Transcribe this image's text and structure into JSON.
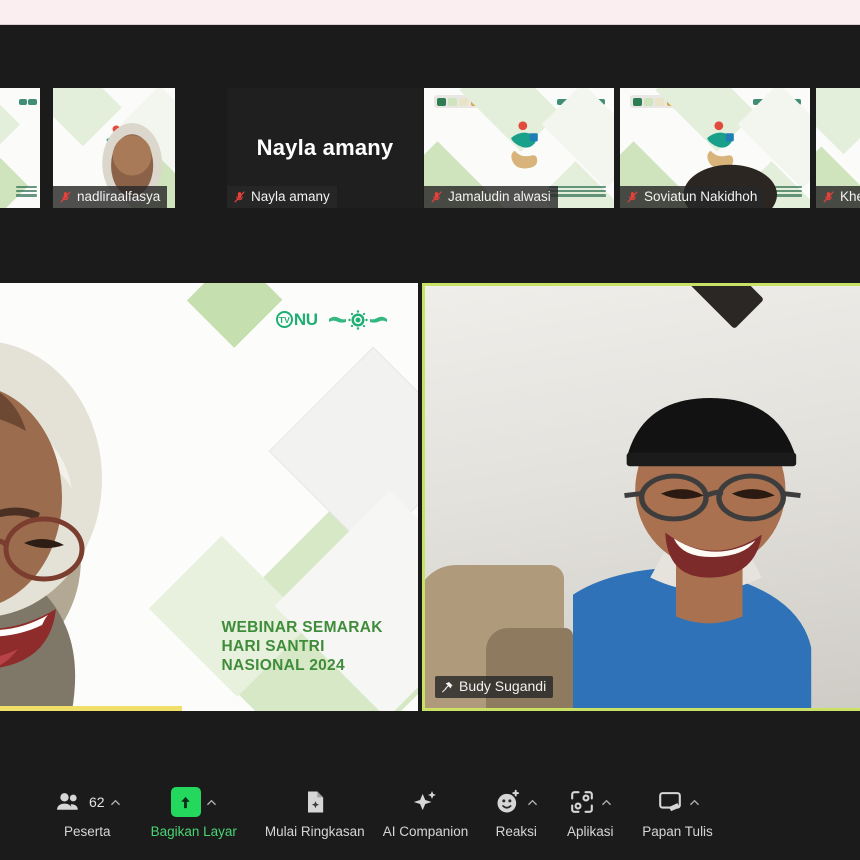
{
  "window": {
    "app": "Zoom Meeting",
    "top_band_color": "#faeef1",
    "background_color": "#1b1b1b"
  },
  "filmstrip": {
    "tiles": [
      {
        "name": "",
        "label": "",
        "has_video": true,
        "muted": true,
        "partial": "left"
      },
      {
        "name": "nadliraalfasya",
        "label": "nadliraalfasya",
        "has_video": true,
        "muted": true
      },
      {
        "name": "Nayla amany",
        "label": "Nayla amany",
        "has_video": false,
        "muted": true
      },
      {
        "name": "Jamaludin alwasi",
        "label": "Jamaludin alwasi",
        "has_video": true,
        "muted": true
      },
      {
        "name": "Soviatun Nakidhoh",
        "label": "Soviatun Nakidhoh",
        "has_video": true,
        "muted": true
      },
      {
        "name": "Khe",
        "label": "Khe",
        "has_video": true,
        "muted": true,
        "partial": "right"
      }
    ],
    "mic_icon": "microphone-off-icon",
    "mic_icon_color": "#e8413a"
  },
  "stage": {
    "left_tile": {
      "name": "webinar-presenter",
      "active_speaker": true,
      "active_border_color": "#f0e06a",
      "slide": {
        "logo_primary": "TV",
        "logo_text": "NU",
        "logo_color": "#1faf73",
        "title_line1": "WEBINAR SEMARAK",
        "title_line2": "HARI SANTRI",
        "title_line3": "NASIONAL 2024",
        "title_color": "#3f8c3a"
      }
    },
    "right_tile": {
      "name": "Budy Sugandi",
      "label": "Budy Sugandi",
      "pinned": true,
      "pin_icon": "pin-icon",
      "highlight_border_color": "#c9e265"
    }
  },
  "toolbar": {
    "items": [
      {
        "id": "participants",
        "label": "Peserta",
        "icon": "participants-icon",
        "count": "62",
        "has_caret": true,
        "active": false
      },
      {
        "id": "share-screen",
        "label": "Bagikan Layar",
        "icon": "share-screen-icon",
        "has_caret": true,
        "active": true,
        "accent": "#23d85c"
      },
      {
        "id": "summary",
        "label": "Mulai Ringkasan",
        "icon": "summary-doc-icon",
        "has_caret": false,
        "active": false
      },
      {
        "id": "ai-companion",
        "label": "AI Companion",
        "icon": "sparkle-icon",
        "has_caret": false,
        "active": false
      },
      {
        "id": "reactions",
        "label": "Reaksi",
        "icon": "smiley-reaction-icon",
        "has_caret": true,
        "active": false
      },
      {
        "id": "apps",
        "label": "Aplikasi",
        "icon": "apps-icon",
        "has_caret": true,
        "active": false
      },
      {
        "id": "whiteboard",
        "label": "Papan Tulis",
        "icon": "whiteboard-icon",
        "has_caret": true,
        "active": false
      }
    ]
  }
}
